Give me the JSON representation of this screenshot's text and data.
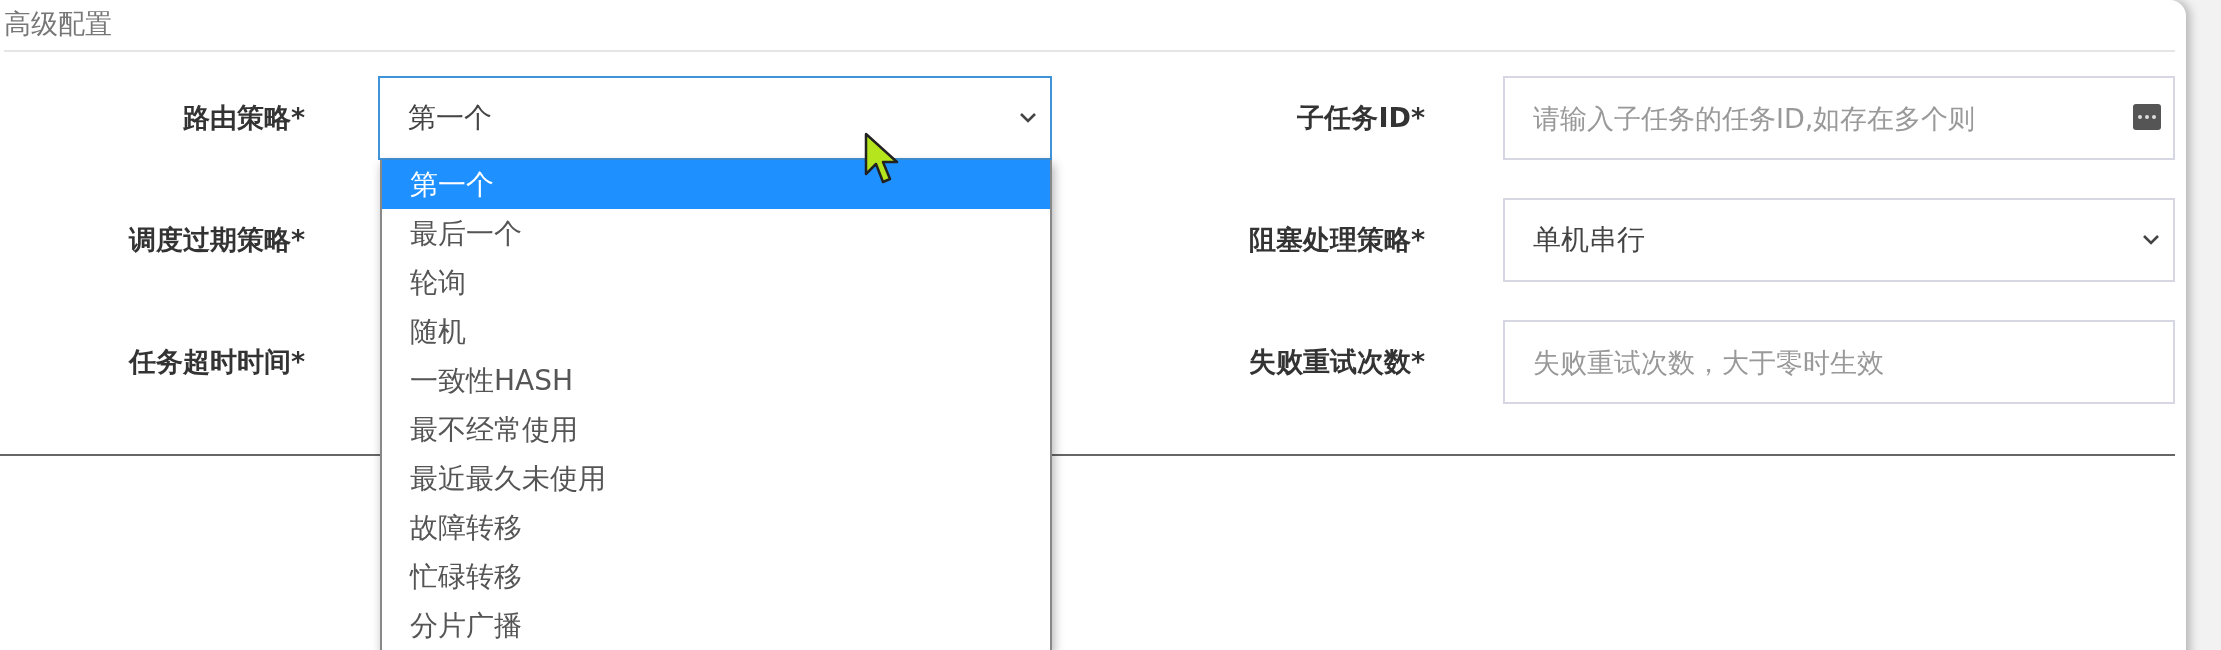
{
  "section_title": "高级配置",
  "fields": [
    {
      "label": "路由策略*",
      "kind": "select",
      "value": "第一个",
      "focused": true,
      "expanded": true,
      "options": [
        {
          "label": "第一个",
          "selected": true
        },
        {
          "label": "最后一个",
          "selected": false
        },
        {
          "label": "轮询",
          "selected": false
        },
        {
          "label": "随机",
          "selected": false
        },
        {
          "label": "一致性HASH",
          "selected": false
        },
        {
          "label": "最不经常使用",
          "selected": false
        },
        {
          "label": "最近最久未使用",
          "selected": false
        },
        {
          "label": "故障转移",
          "selected": false
        },
        {
          "label": "忙碌转移",
          "selected": false
        },
        {
          "label": "分片广播",
          "selected": false
        }
      ]
    },
    {
      "label": "子任务ID*",
      "kind": "input",
      "placeholder": "请输入子任务的任务ID,如存在多个则",
      "focused": false
    },
    {
      "label": "调度过期策略*",
      "kind": "covered"
    },
    {
      "label": "阻塞处理策略*",
      "kind": "select",
      "value": "单机串行",
      "focused": false,
      "expanded": false
    },
    {
      "label": "任务超时时间*",
      "kind": "covered"
    },
    {
      "label": "失败重试次数*",
      "kind": "input",
      "placeholder": "失败重试次数，大于零时生效",
      "focused": false
    }
  ]
}
